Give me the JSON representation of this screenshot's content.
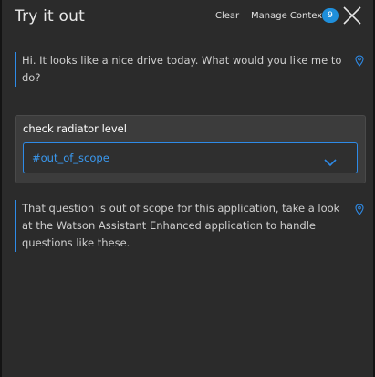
{
  "header": {
    "title": "Try it out",
    "clear_label": "Clear",
    "manage_context_label": "Manage Context",
    "context_count": "9",
    "close_icon": "close-icon"
  },
  "conversation": {
    "bot_greeting": "Hi. It looks like a nice drive today. What would you like me to do?",
    "user_message": "check radiator level",
    "detected_intent": "#out_of_scope",
    "bot_response": "That question is out of scope for this application, take a look at the Watson Assistant Enhanced application to handle questions like these.",
    "pin_icon": "location-pin-icon",
    "dropdown_icon": "chevron-down-icon"
  },
  "colors": {
    "panel_background": "#2b2b2b",
    "accent_blue": "#2e8be8",
    "badge_blue": "#1f8fdb",
    "card_background": "#3c3c3c"
  }
}
